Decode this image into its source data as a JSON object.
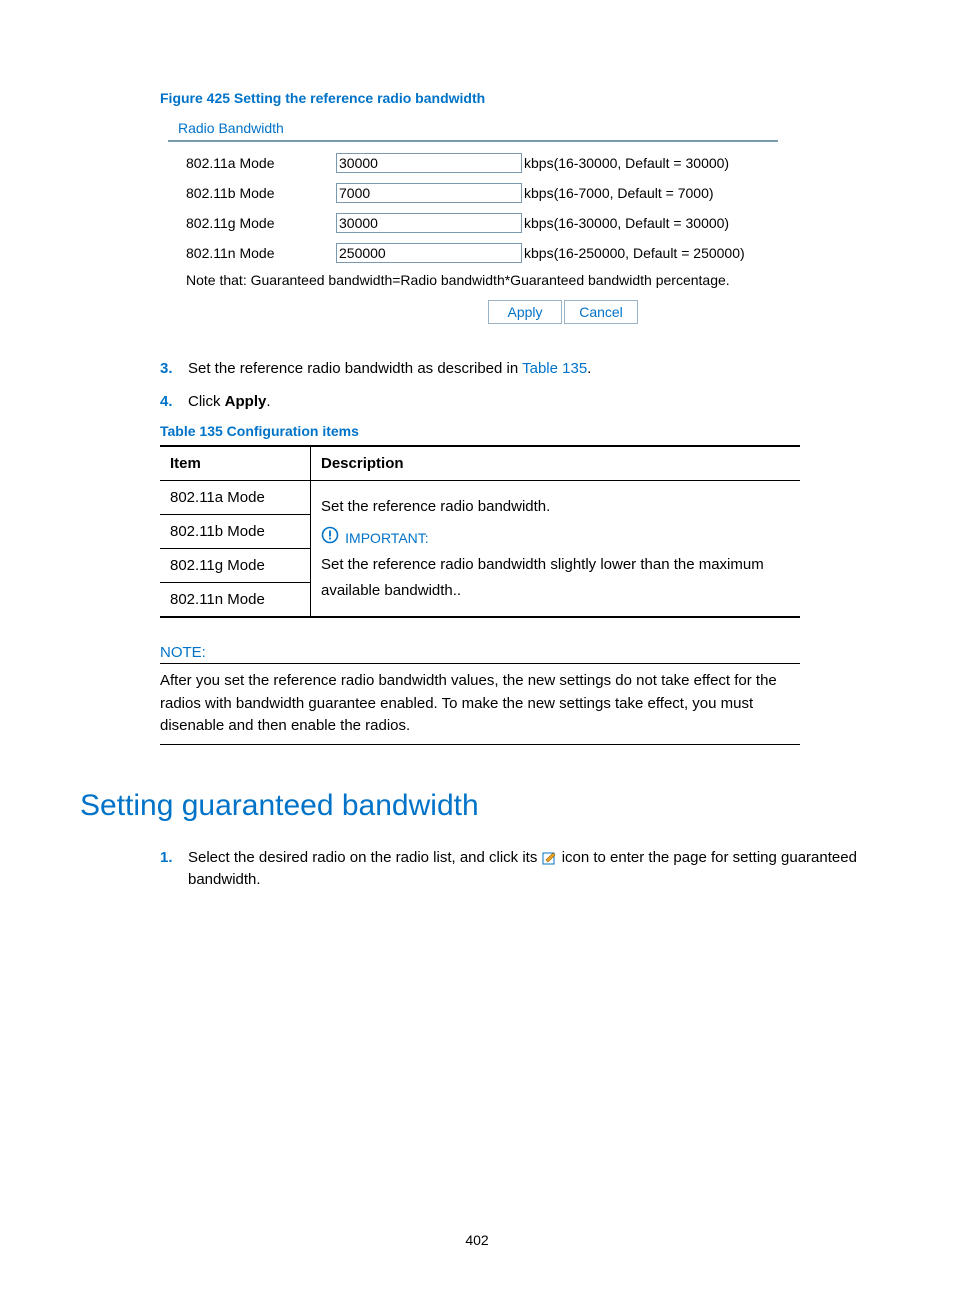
{
  "figure": {
    "caption": "Figure 425 Setting the reference radio bandwidth",
    "panel_title": "Radio Bandwidth",
    "rows": [
      {
        "label": "802.11a Mode",
        "value": "30000",
        "hint": "kbps(16-30000, Default = 30000)"
      },
      {
        "label": "802.11b Mode",
        "value": "7000",
        "hint": "kbps(16-7000, Default = 7000)"
      },
      {
        "label": "802.11g Mode",
        "value": "30000",
        "hint": "kbps(16-30000, Default = 30000)"
      },
      {
        "label": "802.11n Mode",
        "value": "250000",
        "hint": "kbps(16-250000, Default = 250000)"
      }
    ],
    "note": "Note that: Guaranteed bandwidth=Radio bandwidth*Guaranteed bandwidth percentage.",
    "apply_label": "Apply",
    "cancel_label": "Cancel"
  },
  "steps_a": {
    "items": [
      {
        "num": "3.",
        "pre": "Set the reference radio bandwidth as described in ",
        "link": "Table 135",
        "post": "."
      },
      {
        "num": "4.",
        "pre": "Click ",
        "bold": "Apply",
        "post": "."
      }
    ]
  },
  "table": {
    "caption": "Table 135 Configuration items",
    "head_item": "Item",
    "head_desc": "Description",
    "items": [
      "802.11a Mode",
      "802.11b Mode",
      "802.11g Mode",
      "802.11n Mode"
    ],
    "desc_line1": "Set the reference radio bandwidth.",
    "important_label": "IMPORTANT:",
    "desc_line2": "Set the reference radio bandwidth slightly lower than the maximum available bandwidth.."
  },
  "note": {
    "head": "NOTE:",
    "body": "After you set the reference radio bandwidth values, the new settings do not take effect for the radios with bandwidth guarantee enabled. To make the new settings take effect, you must disenable and then enable the radios."
  },
  "section_heading": "Setting guaranteed bandwidth",
  "steps_b": {
    "items": [
      {
        "num": "1.",
        "pre": "Select the desired radio on the radio list, and click its ",
        "post": " icon to enter the page for setting guaranteed bandwidth."
      }
    ]
  },
  "page_number": "402"
}
